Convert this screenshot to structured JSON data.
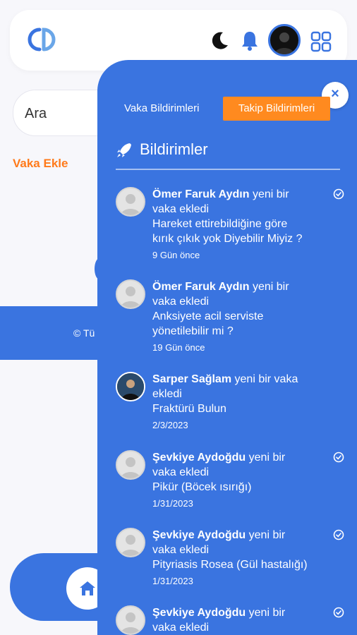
{
  "search": {
    "placeholder": "Ara"
  },
  "background": {
    "add_case_link": "Vaka Ekle",
    "footer_text": "© Tü"
  },
  "panel": {
    "tabs": [
      {
        "label": "Vaka Bildirimleri",
        "active": false
      },
      {
        "label": "Takip Bildirimleri",
        "active": true
      }
    ],
    "close_label": "×",
    "title": "Bildirimler",
    "notifications": [
      {
        "name": "Ömer Faruk Aydın",
        "action_line1": "yeni bir",
        "action_line2": "vaka ekledi",
        "case_line1": "Hareket ettirebildiğine göre",
        "case_line2": "kırık çıkık yok Diyebilir Miyiz ?",
        "time": "9 Gün önce",
        "read": true,
        "avatar": "placeholder-avatar"
      },
      {
        "name": "Ömer Faruk Aydın",
        "action_line1": "yeni bir",
        "action_line2": "vaka ekledi",
        "case_line1": "Anksiyete acil serviste",
        "case_line2": "yönetilebilir mi ?",
        "time": "19 Gün önce",
        "read": false,
        "avatar": "placeholder-avatar"
      },
      {
        "name": "Sarper Sağlam",
        "action_line1": "yeni bir vaka",
        "action_line2": "ekledi",
        "case_line1": "Fraktürü Bulun",
        "case_line2": "",
        "time": "2/3/2023",
        "read": false,
        "avatar": "photo-avatar"
      },
      {
        "name": "Şevkiye Aydoğdu",
        "action_line1": "yeni bir",
        "action_line2": "vaka ekledi",
        "case_line1": "Pikür (Böcek ısırığı)",
        "case_line2": "",
        "time": "1/31/2023",
        "read": true,
        "avatar": "placeholder-avatar"
      },
      {
        "name": "Şevkiye Aydoğdu",
        "action_line1": "yeni bir",
        "action_line2": "vaka ekledi",
        "case_line1": "Pityriasis Rosea (Gül hastalığı)",
        "case_line2": "",
        "time": "1/31/2023",
        "read": true,
        "avatar": "placeholder-avatar"
      },
      {
        "name": "Şevkiye Aydoğdu",
        "action_line1": "yeni bir",
        "action_line2": "vaka ekledi",
        "case_line1": "",
        "case_line2": "",
        "time": "",
        "read": true,
        "avatar": "placeholder-avatar"
      }
    ]
  },
  "colors": {
    "primary": "#3a74e0",
    "accent": "#ff8a1f",
    "white": "#ffffff"
  }
}
